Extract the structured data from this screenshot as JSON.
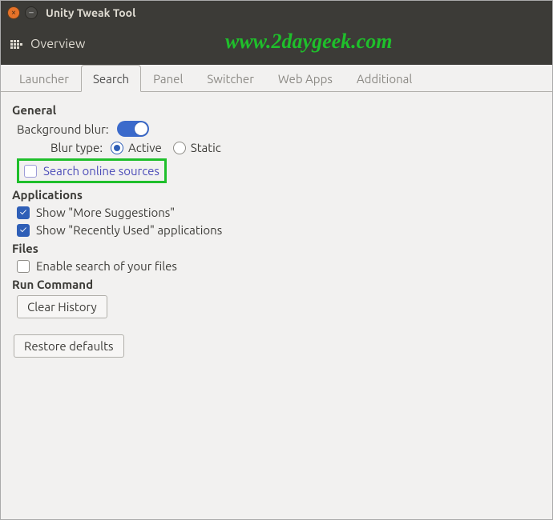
{
  "window": {
    "title": "Unity Tweak Tool"
  },
  "toolbar": {
    "overview": "Overview"
  },
  "watermark": "www.2daygeek.com",
  "tabs": {
    "launcher": "Launcher",
    "search": "Search",
    "panel": "Panel",
    "switcher": "Switcher",
    "webapps": "Web Apps",
    "additional": "Additional"
  },
  "general": {
    "header": "General",
    "background_blur_label": "Background blur:",
    "blur_type_label": "Blur type:",
    "blur_active": "Active",
    "blur_static": "Static",
    "search_online_sources": "Search online sources"
  },
  "applications": {
    "header": "Applications",
    "more_suggestions": "Show \"More Suggestions\"",
    "recently_used": "Show \"Recently Used\" applications"
  },
  "files": {
    "header": "Files",
    "enable_search": "Enable search of your files"
  },
  "run_command": {
    "header": "Run Command",
    "clear_history": "Clear History"
  },
  "restore_defaults": "Restore defaults"
}
